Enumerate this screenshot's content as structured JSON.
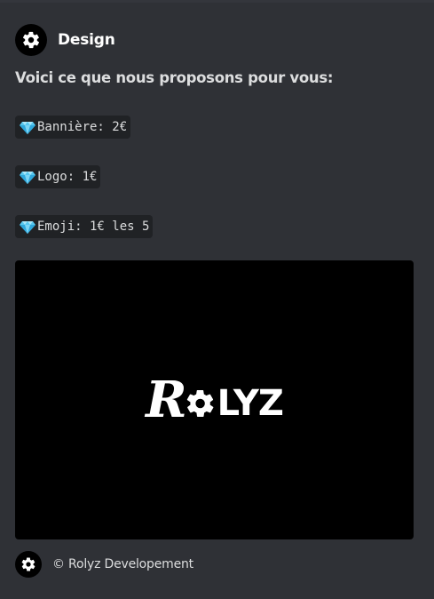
{
  "embed": {
    "author": {
      "name": "Design",
      "icon": "gear-icon"
    },
    "description_title": "Voici ce que nous proposons pour vous:",
    "items": [
      {
        "icon": "gem-icon",
        "text": "Bannière: 2€"
      },
      {
        "icon": "gem-icon",
        "text": "Logo: 1€"
      },
      {
        "icon": "gem-icon",
        "text": "Emoji: 1€ les 5"
      }
    ],
    "image": {
      "logo_text_first": "R",
      "logo_text_rest": "LYZ"
    },
    "footer": {
      "text": "© Rolyz Developement",
      "icon": "gear-icon"
    }
  },
  "colors": {
    "background": "#2f3136",
    "code_background": "#202225",
    "text": "#dcddde",
    "heading": "#ffffff",
    "gem": "#56c7ef"
  }
}
